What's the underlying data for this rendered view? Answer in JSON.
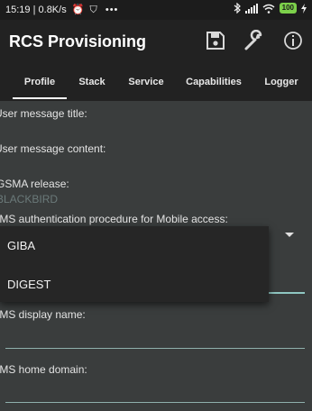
{
  "status_bar": {
    "time": "15:19",
    "speed": "0.8K/s",
    "icons": [
      "alarm-icon",
      "shield-icon",
      "overflow-dots-icon",
      "bluetooth-icon",
      "signal-icon",
      "wifi-icon",
      "battery-icon",
      "charging-icon"
    ],
    "battery": "100"
  },
  "app_bar": {
    "title": "RCS Provisioning",
    "actions": [
      "save-icon",
      "wrench-icon",
      "info-icon"
    ]
  },
  "tabs": [
    {
      "label": "Profile",
      "active": true
    },
    {
      "label": "Stack",
      "active": false
    },
    {
      "label": "Service",
      "active": false
    },
    {
      "label": "Capabilities",
      "active": false
    },
    {
      "label": "Logger",
      "active": false
    }
  ],
  "form": {
    "user_message_title_label": "User message title:",
    "user_message_content_label": "User message content:",
    "gsma_release_label": "GSMA release:",
    "gsma_release_value": "BLACKBIRD",
    "ims_auth_label": "IMS authentication procedure for Mobile access:",
    "ims_display_name_label": "IMS display name:",
    "ims_home_domain_label": "IMS home domain:"
  },
  "dropdown": {
    "options": [
      "GIBA",
      "DIGEST"
    ]
  },
  "colors": {
    "background": "#3a3d3d",
    "bar": "#222222",
    "accent": "#8fc7c2",
    "battery": "#7cd04a"
  }
}
